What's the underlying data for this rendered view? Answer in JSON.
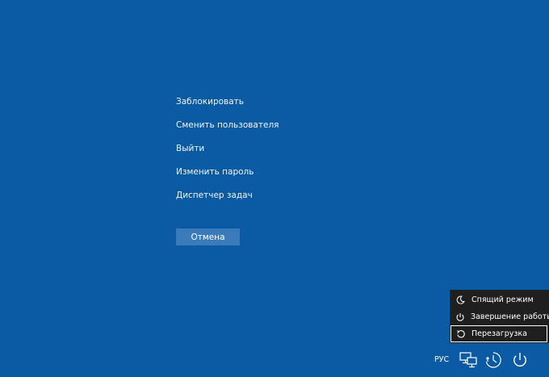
{
  "menu": {
    "items": [
      {
        "label": "Заблокировать"
      },
      {
        "label": "Сменить пользователя"
      },
      {
        "label": "Выйти"
      },
      {
        "label": "Изменить пароль"
      },
      {
        "label": "Диспетчер задач"
      }
    ],
    "cancel_label": "Отмена"
  },
  "power_menu": {
    "items": [
      {
        "label": "Спящий режим",
        "icon": "moon-icon"
      },
      {
        "label": "Завершение работы",
        "icon": "power-icon"
      },
      {
        "label": "Перезагрузка",
        "icon": "restart-icon",
        "selected": true
      }
    ]
  },
  "tray": {
    "language": "РУС",
    "icons": [
      "network-icon",
      "accessibility-icon",
      "power-icon"
    ]
  },
  "colors": {
    "background": "#0a5aa4",
    "button": "#3b7bbc",
    "power_menu_bg": "#1f1f1f",
    "text": "#ffffff"
  }
}
